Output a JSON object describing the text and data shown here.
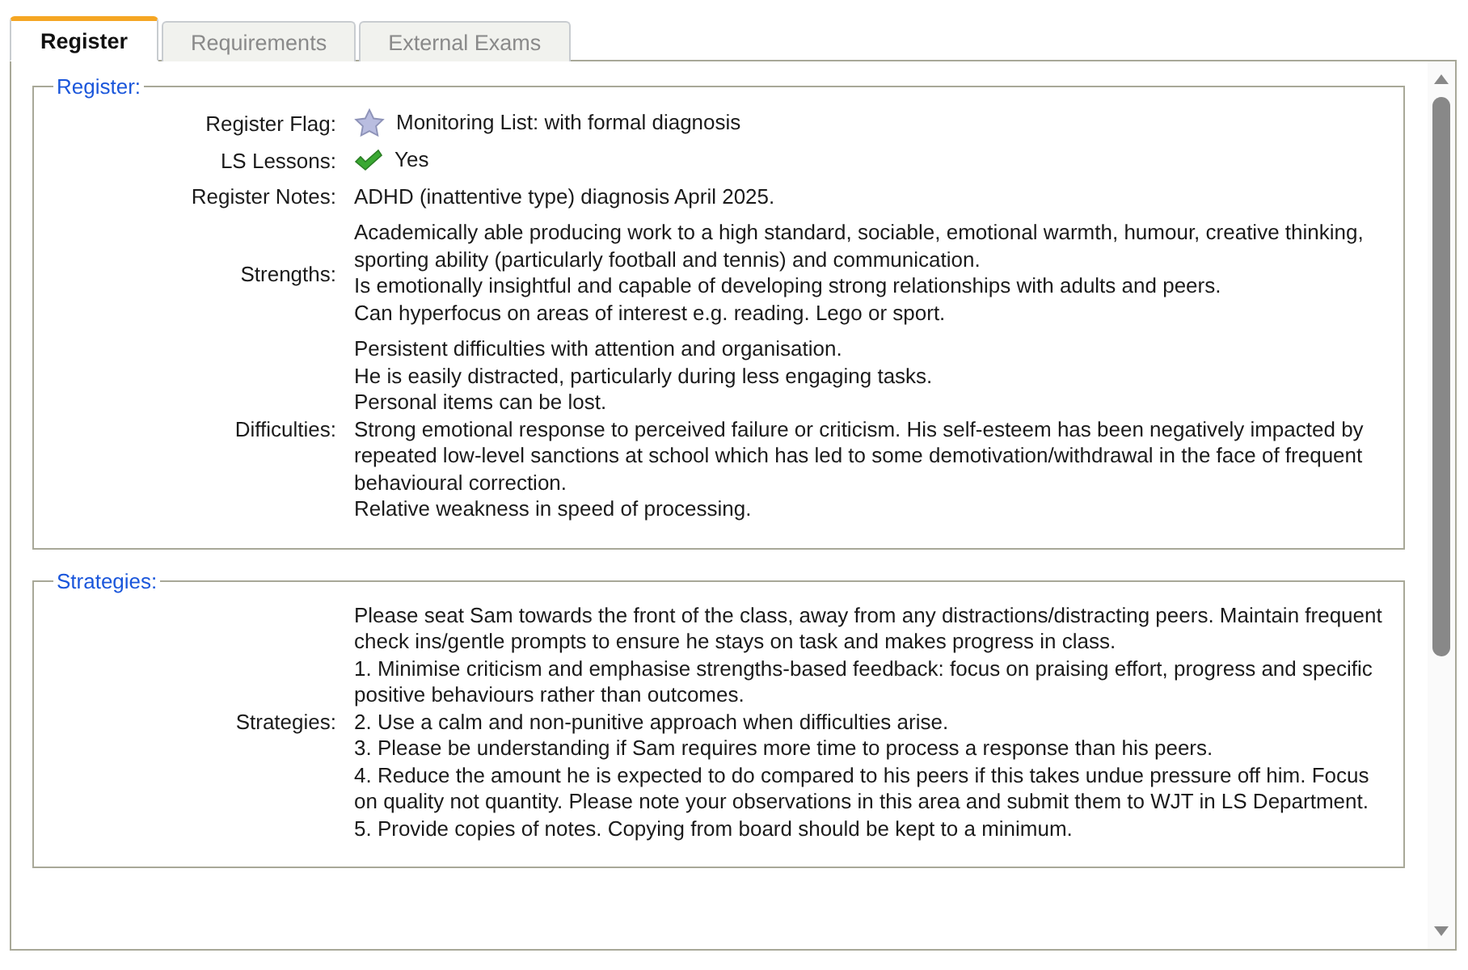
{
  "tabs": [
    {
      "label": "Register",
      "selected": true
    },
    {
      "label": "Requirements",
      "selected": false
    },
    {
      "label": "External Exams",
      "selected": false
    }
  ],
  "sections": [
    {
      "legend": "Register:",
      "fields": [
        {
          "label": "Register Flag:",
          "kind": "flag",
          "paragraphs": [
            "Monitoring List: with formal diagnosis"
          ]
        },
        {
          "label": "LS Lessons:",
          "kind": "check",
          "paragraphs": [
            "Yes"
          ]
        },
        {
          "label": "Register Notes:",
          "kind": "text",
          "paragraphs": [
            "ADHD (inattentive type) diagnosis April 2025."
          ]
        },
        {
          "label": "Strengths:",
          "kind": "text",
          "paragraphs": [
            "Academically able producing work to a high standard, sociable, emotional warmth, humour, creative thinking, sporting ability (particularly football and tennis) and communication.",
            "Is emotionally insightful and capable of developing strong relationships with adults and peers.",
            "Can hyperfocus on areas of interest e.g. reading. Lego or sport."
          ]
        },
        {
          "label": "Difficulties:",
          "kind": "text",
          "paragraphs": [
            "Persistent difficulties with attention and organisation.",
            "He is easily distracted, particularly during less engaging tasks.",
            "Personal items can be lost.",
            "Strong emotional response to perceived failure or criticism. His self-esteem has been negatively impacted by repeated low-level sanctions at school which has led to some demotivation/withdrawal in the face of frequent behavioural correction.",
            "Relative weakness in speed of processing."
          ]
        }
      ]
    },
    {
      "legend": "Strategies:",
      "fields": [
        {
          "label": "Strategies:",
          "kind": "text",
          "paragraphs": [
            "Please seat Sam towards the front of the class, away from any distractions/distracting peers. Maintain frequent check ins/gentle prompts to ensure he stays on task and makes progress in class.",
            "1. Minimise criticism and emphasise strengths-based feedback: focus on praising effort, progress and specific positive behaviours rather than outcomes.",
            "2. Use a calm and non-punitive approach when difficulties arise.",
            "3. Please be understanding if Sam requires more time to process a response than his peers.",
            "4. Reduce the amount he is expected to do compared to his peers if this takes undue pressure off him. Focus on quality not quantity. Please note your observations in this area and submit them to WJT in LS Department.",
            "5. Provide copies of notes. Copying from board should be kept to a minimum."
          ]
        }
      ]
    }
  ]
}
